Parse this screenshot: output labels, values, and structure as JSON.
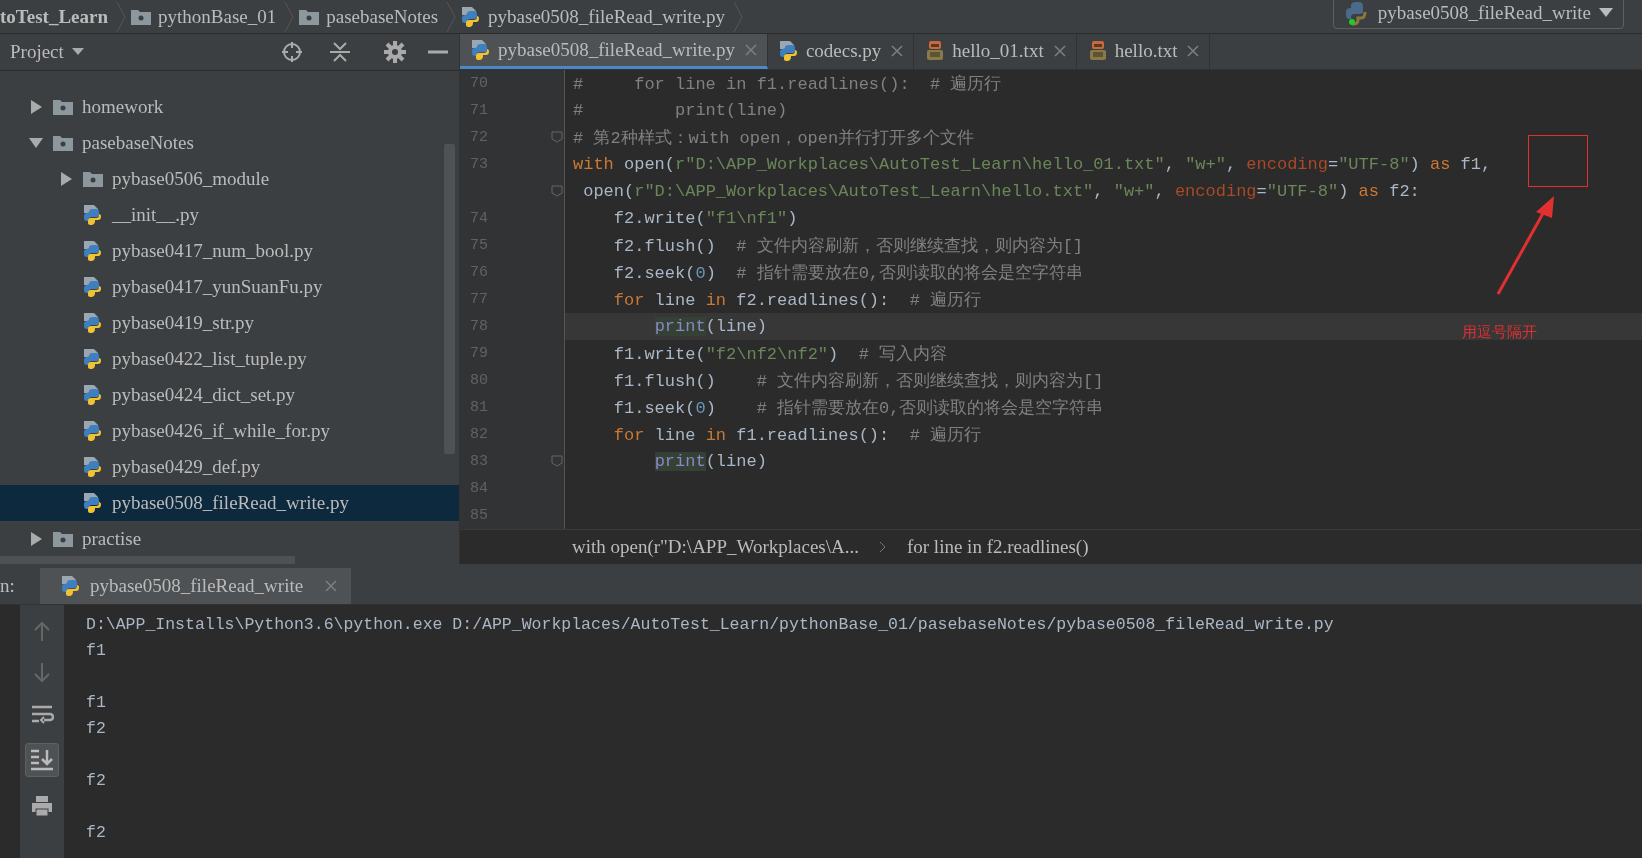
{
  "breadcrumb": [
    {
      "label": "toTest_Learn",
      "kind": "plain"
    },
    {
      "label": "pythonBase_01",
      "kind": "folder"
    },
    {
      "label": "pasebaseNotes",
      "kind": "folder"
    },
    {
      "label": "pybase0508_fileRead_write.py",
      "kind": "python"
    }
  ],
  "run_config": {
    "label": "pybase0508_fileRead_write"
  },
  "project_panel": {
    "title": "Project",
    "tree": [
      {
        "label": "homework",
        "kind": "folder",
        "expanded": false,
        "selected": false
      },
      {
        "label": "pasebaseNotes",
        "kind": "folder",
        "expanded": true,
        "selected": false,
        "children": [
          {
            "label": "pybase0506_module",
            "kind": "folder",
            "expanded": false,
            "selected": false
          },
          {
            "label": "__init__.py",
            "kind": "python",
            "selected": false
          },
          {
            "label": "pybase0417_num_bool.py",
            "kind": "python",
            "selected": false
          },
          {
            "label": "pybase0417_yunSuanFu.py",
            "kind": "python",
            "selected": false
          },
          {
            "label": "pybase0419_str.py",
            "kind": "python",
            "selected": false
          },
          {
            "label": "pybase0422_list_tuple.py",
            "kind": "python",
            "selected": false
          },
          {
            "label": "pybase0424_dict_set.py",
            "kind": "python",
            "selected": false
          },
          {
            "label": "pybase0426_if_while_for.py",
            "kind": "python",
            "selected": false
          },
          {
            "label": "pybase0429_def.py",
            "kind": "python",
            "selected": false
          },
          {
            "label": "pybase0508_fileRead_write.py",
            "kind": "python",
            "selected": true
          }
        ]
      },
      {
        "label": "practise",
        "kind": "folder",
        "expanded": false,
        "selected": false
      }
    ]
  },
  "editor_tabs": [
    {
      "label": "pybase0508_fileRead_write.py",
      "kind": "python",
      "selected": true
    },
    {
      "label": "codecs.py",
      "kind": "python",
      "selected": false
    },
    {
      "label": "hello_01.txt",
      "kind": "text",
      "selected": false
    },
    {
      "label": "hello.txt",
      "kind": "text",
      "selected": false
    }
  ],
  "code_lines": [
    {
      "number": "70",
      "tokens": [
        {
          "kind": "comment",
          "text": "#     for line in f1.readlines():  # 遍历行"
        }
      ]
    },
    {
      "number": "71",
      "tokens": [
        {
          "kind": "comment",
          "text": "#         print(line)"
        }
      ]
    },
    {
      "number": "72",
      "fold": true,
      "tokens": [
        {
          "kind": "comment",
          "text": "# 第2种样式：with open，open并行打开多个文件"
        }
      ]
    },
    {
      "number": "73",
      "tokens": [
        {
          "kind": "kw",
          "text": "with"
        },
        {
          "kind": "plain",
          "text": " open("
        },
        {
          "kind": "str",
          "text": "r\"D:\\APP_Workplaces\\AutoTest_Learn\\hello_01.txt\""
        },
        {
          "kind": "plain",
          "text": ", "
        },
        {
          "kind": "str",
          "text": "\"w+\""
        },
        {
          "kind": "plain",
          "text": ", "
        },
        {
          "kind": "param",
          "text": "encoding"
        },
        {
          "kind": "plain",
          "text": "="
        },
        {
          "kind": "str",
          "text": "\"UTF-8\""
        },
        {
          "kind": "plain",
          "text": ") "
        },
        {
          "kind": "kw",
          "text": "as"
        },
        {
          "kind": "plain",
          "text": " f1,"
        }
      ]
    },
    {
      "fold": true,
      "tokens": [
        {
          "kind": "plain",
          "text": " open("
        },
        {
          "kind": "str",
          "text": "r\"D:\\APP_Workplaces\\AutoTest_Learn\\hello.txt\""
        },
        {
          "kind": "plain",
          "text": ", "
        },
        {
          "kind": "str",
          "text": "\"w+\""
        },
        {
          "kind": "plain",
          "text": ", "
        },
        {
          "kind": "param",
          "text": "encoding"
        },
        {
          "kind": "plain",
          "text": "="
        },
        {
          "kind": "str",
          "text": "\"UTF-8\""
        },
        {
          "kind": "plain",
          "text": ") "
        },
        {
          "kind": "kw",
          "text": "as"
        },
        {
          "kind": "plain",
          "text": " f2:"
        }
      ]
    },
    {
      "number": "74",
      "tokens": [
        {
          "kind": "plain",
          "text": "    f2.write("
        },
        {
          "kind": "str",
          "text": "\"f1\\nf1\""
        },
        {
          "kind": "plain",
          "text": ")"
        }
      ]
    },
    {
      "number": "75",
      "tokens": [
        {
          "kind": "plain",
          "text": "    f2.flush()  "
        },
        {
          "kind": "comment",
          "text": "# 文件内容刷新，否则继续查找，则内容为[]"
        }
      ]
    },
    {
      "number": "76",
      "tokens": [
        {
          "kind": "plain",
          "text": "    f2.seek("
        },
        {
          "kind": "num",
          "text": "0"
        },
        {
          "kind": "plain",
          "text": ")  "
        },
        {
          "kind": "comment",
          "text": "# 指针需要放在0,否则读取的将会是空字符串"
        }
      ]
    },
    {
      "number": "77",
      "tokens": [
        {
          "kind": "kw",
          "text": "    for"
        },
        {
          "kind": "plain",
          "text": " line "
        },
        {
          "kind": "kw",
          "text": "in"
        },
        {
          "kind": "plain",
          "text": " f2.readlines():  "
        },
        {
          "kind": "comment",
          "text": "# 遍历行"
        }
      ]
    },
    {
      "number": "78",
      "current": true,
      "tokens": [
        {
          "kind": "builtin",
          "text": "        print"
        },
        {
          "kind": "plain",
          "text": "(line)"
        }
      ]
    },
    {
      "number": "79",
      "tokens": [
        {
          "kind": "plain",
          "text": "    f1.write("
        },
        {
          "kind": "str",
          "text": "\"f2\\nf2\\nf2\""
        },
        {
          "kind": "plain",
          "text": ")  "
        },
        {
          "kind": "comment",
          "text": "# 写入内容"
        }
      ]
    },
    {
      "number": "80",
      "tokens": [
        {
          "kind": "plain",
          "text": "    f1.flush()    "
        },
        {
          "kind": "comment",
          "text": "# 文件内容刷新，否则继续查找，则内容为[]"
        }
      ]
    },
    {
      "number": "81",
      "tokens": [
        {
          "kind": "plain",
          "text": "    f1.seek("
        },
        {
          "kind": "num",
          "text": "0"
        },
        {
          "kind": "plain",
          "text": ")    "
        },
        {
          "kind": "comment",
          "text": "# 指针需要放在0,否则读取的将会是空字符串"
        }
      ]
    },
    {
      "number": "82",
      "tokens": [
        {
          "kind": "kw",
          "text": "    for"
        },
        {
          "kind": "plain",
          "text": " line "
        },
        {
          "kind": "kw",
          "text": "in"
        },
        {
          "kind": "plain",
          "text": " f1.readlines():  "
        },
        {
          "kind": "comment",
          "text": "# 遍历行"
        }
      ]
    },
    {
      "number": "83",
      "fold": true,
      "tokens": [
        {
          "kind": "builtin",
          "text": "        print"
        },
        {
          "kind": "plain",
          "text": "(line)"
        }
      ]
    },
    {
      "number": "84"
    },
    {
      "number": "85"
    }
  ],
  "editor_breadcrumb": [
    "with open(r\"D:\\APP_Workplaces\\A...",
    "for line in f2.readlines()"
  ],
  "annotation": {
    "text": "用逗号隔开"
  },
  "run_panel": {
    "prefix": "n:",
    "tab": {
      "label": "pybase0508_fileRead_write"
    },
    "output": [
      {
        "kind": "text",
        "text": "D:\\APP_Installs\\Python3.6\\python.exe D:/APP_Workplaces/AutoTest_Learn/pythonBase_01/pasebaseNotes/pybase0508_fileRead_write.py"
      },
      {
        "kind": "text",
        "text": "f1"
      },
      {
        "kind": "blank"
      },
      {
        "kind": "text",
        "text": "f1"
      },
      {
        "kind": "text",
        "text": "f2"
      },
      {
        "kind": "blank"
      },
      {
        "kind": "text",
        "text": "f2"
      },
      {
        "kind": "blank"
      },
      {
        "kind": "text",
        "text": "f2"
      }
    ]
  }
}
